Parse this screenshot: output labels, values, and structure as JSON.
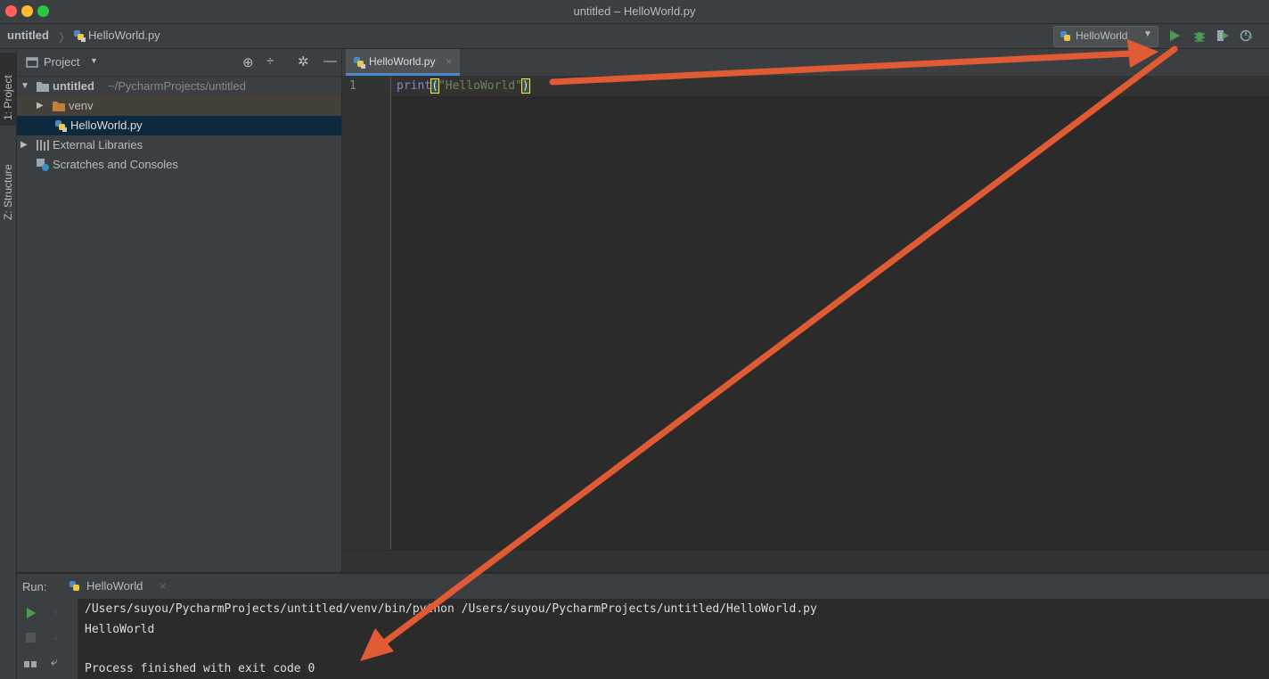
{
  "window": {
    "title": "untitled – HelloWorld.py"
  },
  "navbar": {
    "project_crumb": "untitled",
    "file_crumb": "HelloWorld.py",
    "run_config": "HelloWorld"
  },
  "side_tabs": {
    "project": "1: Project",
    "structure": "Z: Structure"
  },
  "project_panel": {
    "title": "Project",
    "root_name": "untitled",
    "root_path": "~/PycharmProjects/untitled",
    "items": [
      {
        "label": "venv"
      },
      {
        "label": "HelloWorld.py"
      },
      {
        "label": "External Libraries"
      },
      {
        "label": "Scratches and Consoles"
      }
    ]
  },
  "editor": {
    "tab_label": "HelloWorld.py",
    "line_number": "1",
    "code_fn": "print",
    "code_open": "(",
    "code_string": "\"HelloWorld\"",
    "code_close": ")"
  },
  "run_panel": {
    "label": "Run:",
    "tab_label": "HelloWorld",
    "console_lines": [
      "/Users/suyou/PycharmProjects/untitled/venv/bin/python /Users/suyou/PycharmProjects/untitled/HelloWorld.py",
      "HelloWorld",
      "",
      "Process finished with exit code 0"
    ]
  },
  "colors": {
    "accent_arrow": "#e05a33",
    "run_green": "#499c54",
    "selection_blue": "#0d293e",
    "string_green": "#6a8759",
    "keyword_purple": "#8888c6"
  }
}
